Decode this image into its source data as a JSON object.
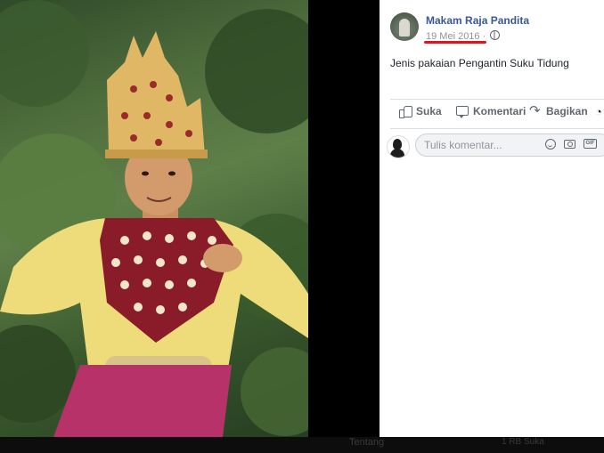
{
  "post": {
    "author": "Makam Raja Pandita",
    "date": "19 Mei 2016",
    "separator": "·",
    "text": "Jenis pakaian Pengantin Suku Tidung",
    "accent_underline_color": "#e0141e"
  },
  "actions": {
    "like_label": "Suka",
    "comment_label": "Komentari",
    "share_label": "Bagikan"
  },
  "comment": {
    "placeholder": "Tulis komentar...",
    "gif_label": "GIF"
  },
  "background_page": {
    "tentang": "Tentang",
    "suka_count": "1 RB Suka"
  },
  "colors": {
    "link": "#385898",
    "meta": "#90949c",
    "action": "#606770"
  }
}
